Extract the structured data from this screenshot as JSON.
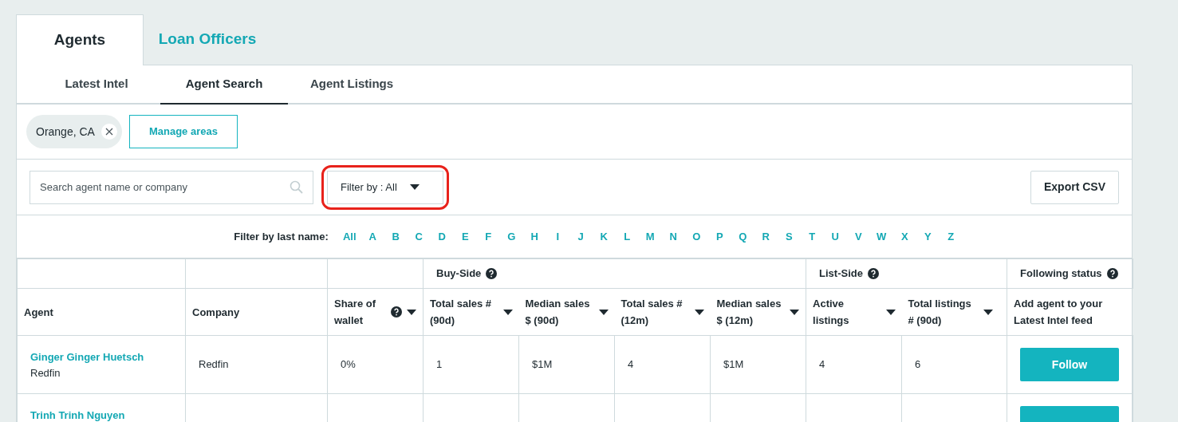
{
  "top_tabs": [
    {
      "label": "Agents",
      "selected": true
    },
    {
      "label": "Loan Officers",
      "selected": false
    }
  ],
  "sub_tabs": [
    {
      "label": "Latest Intel",
      "selected": false
    },
    {
      "label": "Agent Search",
      "selected": true
    },
    {
      "label": "Agent Listings",
      "selected": false
    }
  ],
  "area_chips": [
    {
      "label": "Orange, CA"
    }
  ],
  "manage_areas_button": "Manage areas",
  "search": {
    "placeholder": "Search agent name or company"
  },
  "filter_dropdown": {
    "label": "Filter by : All",
    "highlighted": true
  },
  "export_button": "Export CSV",
  "letter_filter": {
    "label": "Filter by last name:",
    "letters": [
      "All",
      "A",
      "B",
      "C",
      "D",
      "E",
      "F",
      "G",
      "H",
      "I",
      "J",
      "K",
      "L",
      "M",
      "N",
      "O",
      "P",
      "Q",
      "R",
      "S",
      "T",
      "U",
      "V",
      "W",
      "X",
      "Y",
      "Z"
    ]
  },
  "table": {
    "column_groups": [
      {
        "columns": [
          {
            "label": "Agent",
            "help": false,
            "sortable": false
          }
        ]
      },
      {
        "columns": [
          {
            "label": "Company",
            "help": false,
            "sortable": false
          }
        ]
      },
      {
        "columns": [
          {
            "label": "Share of wallet",
            "help": true,
            "sortable": true
          }
        ]
      },
      {
        "label": "Buy-Side",
        "help": true,
        "columns": [
          {
            "label": "Total sales # (90d)",
            "help": false,
            "sortable": true
          },
          {
            "label": "Median sales $ (90d)",
            "help": false,
            "sortable": true
          },
          {
            "label": "Total sales # (12m)",
            "help": false,
            "sortable": true
          },
          {
            "label": "Median sales $ (12m)",
            "help": false,
            "sortable": true
          }
        ]
      },
      {
        "label": "List-Side",
        "help": true,
        "columns": [
          {
            "label": "Active listings",
            "help": false,
            "sortable": true
          },
          {
            "label": "Total listings # (90d)",
            "help": false,
            "sortable": true
          }
        ]
      },
      {
        "label": "Following status",
        "help": true,
        "columns": [
          {
            "label": "Add agent to your Latest Intel feed",
            "help": false,
            "sortable": false
          }
        ]
      }
    ],
    "rows": [
      {
        "agent": "Ginger Ginger Huetsch",
        "agent_company": "Redfin",
        "cells": [
          "Redfin",
          "0%",
          "1",
          "$1M",
          "4",
          "$1M",
          "4",
          "6"
        ],
        "follow_button": "Follow"
      },
      {
        "agent": "Trinh Trinh Nguyen",
        "cells": []
      }
    ]
  }
}
